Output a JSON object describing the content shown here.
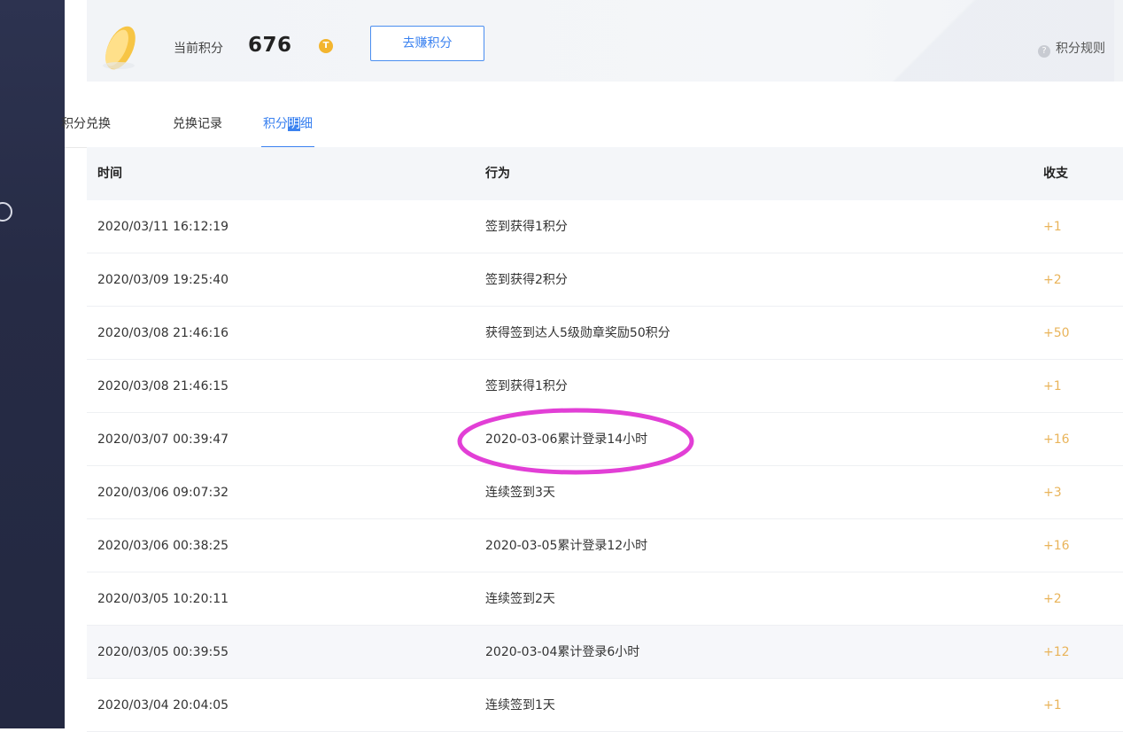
{
  "header": {
    "points_label": "当前积分",
    "points_value": "676",
    "coin_glyph": "T",
    "earn_button": "去赚积分",
    "rules_link": "积分规则",
    "help_glyph": "?"
  },
  "tabs": [
    {
      "label": "积分兑换",
      "active": false
    },
    {
      "label": "兑换记录",
      "active": false
    },
    {
      "label_prefix": "积分",
      "label_highlight": "明",
      "label_suffix": "细",
      "active": true
    }
  ],
  "table": {
    "columns": [
      "时间",
      "行为",
      "收支"
    ],
    "rows": [
      {
        "time": "2020/03/11 16:12:19",
        "action": "签到获得1积分",
        "amount": "+1"
      },
      {
        "time": "2020/03/09 19:25:40",
        "action": "签到获得2积分",
        "amount": "+2"
      },
      {
        "time": "2020/03/08 21:46:16",
        "action": "获得签到达人5级勋章奖励50积分",
        "amount": "+50"
      },
      {
        "time": "2020/03/08 21:46:15",
        "action": "签到获得1积分",
        "amount": "+1"
      },
      {
        "time": "2020/03/07 00:39:47",
        "action": "2020-03-06累计登录14小时",
        "amount": "+16"
      },
      {
        "time": "2020/03/06 09:07:32",
        "action": "连续签到3天",
        "amount": "+3"
      },
      {
        "time": "2020/03/06 00:38:25",
        "action": "2020-03-05累计登录12小时",
        "amount": "+16"
      },
      {
        "time": "2020/03/05 10:20:11",
        "action": "连续签到2天",
        "amount": "+2"
      },
      {
        "time": "2020/03/05 00:39:55",
        "action": "2020-03-04累计登录6小时",
        "amount": "+12"
      },
      {
        "time": "2020/03/04 20:04:05",
        "action": "连续签到1天",
        "amount": "+1"
      }
    ]
  },
  "colors": {
    "accent": "#3b82f0",
    "amount": "#e9b45a",
    "annotation": "#e23fd6",
    "sidebar": "#262b45"
  }
}
